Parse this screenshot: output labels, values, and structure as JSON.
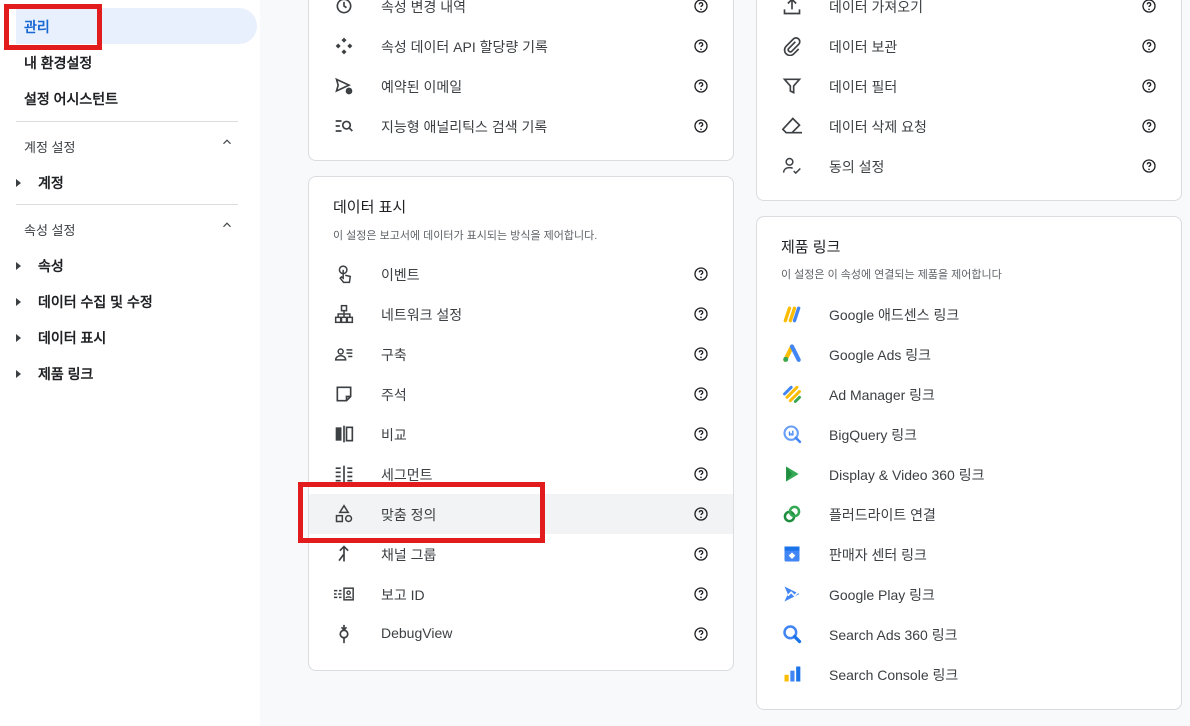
{
  "sidebar": {
    "top_items": [
      {
        "label": "관리",
        "active": true
      },
      {
        "label": "내 환경설정",
        "active": false
      },
      {
        "label": "설정 어시스턴트",
        "active": false
      }
    ],
    "account_section": {
      "heading": "계정 설정",
      "items": [
        "계정"
      ]
    },
    "property_section": {
      "heading": "속성 설정",
      "items": [
        "속성",
        "데이터 수집 및 수정",
        "데이터 표시",
        "제품 링크"
      ]
    }
  },
  "top_left_card": {
    "items": [
      {
        "label": "속성 변경 내역",
        "icon": "history-icon"
      },
      {
        "label": "속성 데이터 API 할당량 기록",
        "icon": "api-quota-icon"
      },
      {
        "label": "예약된 이메일",
        "icon": "scheduled-email-icon"
      },
      {
        "label": "지능형 애널리틱스 검색 기록",
        "icon": "search-history-icon"
      }
    ]
  },
  "data_display_card": {
    "title": "데이터 표시",
    "description": "이 설정은 보고서에 데이터가 표시되는 방식을 제어합니다.",
    "items": [
      {
        "label": "이벤트",
        "icon": "touch-icon"
      },
      {
        "label": "네트워크 설정",
        "icon": "network-icon"
      },
      {
        "label": "구축",
        "icon": "audience-icon"
      },
      {
        "label": "주석",
        "icon": "annotation-icon"
      },
      {
        "label": "비교",
        "icon": "compare-icon"
      },
      {
        "label": "세그먼트",
        "icon": "segment-icon"
      },
      {
        "label": "맞춤 정의",
        "icon": "shapes-icon",
        "highlighted": true
      },
      {
        "label": "채널 그룹",
        "icon": "merge-icon"
      },
      {
        "label": "보고 ID",
        "icon": "reporting-id-icon"
      },
      {
        "label": "DebugView",
        "icon": "debug-icon"
      }
    ]
  },
  "top_right_card": {
    "items": [
      {
        "label": "데이터 가져오기",
        "icon": "upload-icon"
      },
      {
        "label": "데이터 보관",
        "icon": "attach-icon"
      },
      {
        "label": "데이터 필터",
        "icon": "filter-icon"
      },
      {
        "label": "데이터 삭제 요청",
        "icon": "eraser-icon"
      },
      {
        "label": "동의 설정",
        "icon": "consent-icon"
      }
    ]
  },
  "product_links_card": {
    "title": "제품 링크",
    "description": "이 설정은 이 속성에 연결되는 제품을 제어합니다",
    "items": [
      {
        "label": "Google 애드센스 링크",
        "icon": "adsense-logo-icon"
      },
      {
        "label": "Google Ads 링크",
        "icon": "google-ads-logo-icon"
      },
      {
        "label": "Ad Manager 링크",
        "icon": "ad-manager-logo-icon"
      },
      {
        "label": "BigQuery 링크",
        "icon": "bigquery-logo-icon"
      },
      {
        "label": "Display & Video 360 링크",
        "icon": "dv360-logo-icon"
      },
      {
        "label": "플러드라이트 연결",
        "icon": "floodlight-logo-icon"
      },
      {
        "label": "판매자 센터 링크",
        "icon": "merchant-center-logo-icon"
      },
      {
        "label": "Google Play 링크",
        "icon": "google-play-logo-icon"
      },
      {
        "label": "Search Ads 360 링크",
        "icon": "search-ads-360-logo-icon"
      },
      {
        "label": "Search Console 링크",
        "icon": "search-console-logo-icon"
      }
    ]
  },
  "colors": {
    "accent": "#1967d2",
    "highlight": "#e21c1c",
    "icon": "#3c4043"
  }
}
